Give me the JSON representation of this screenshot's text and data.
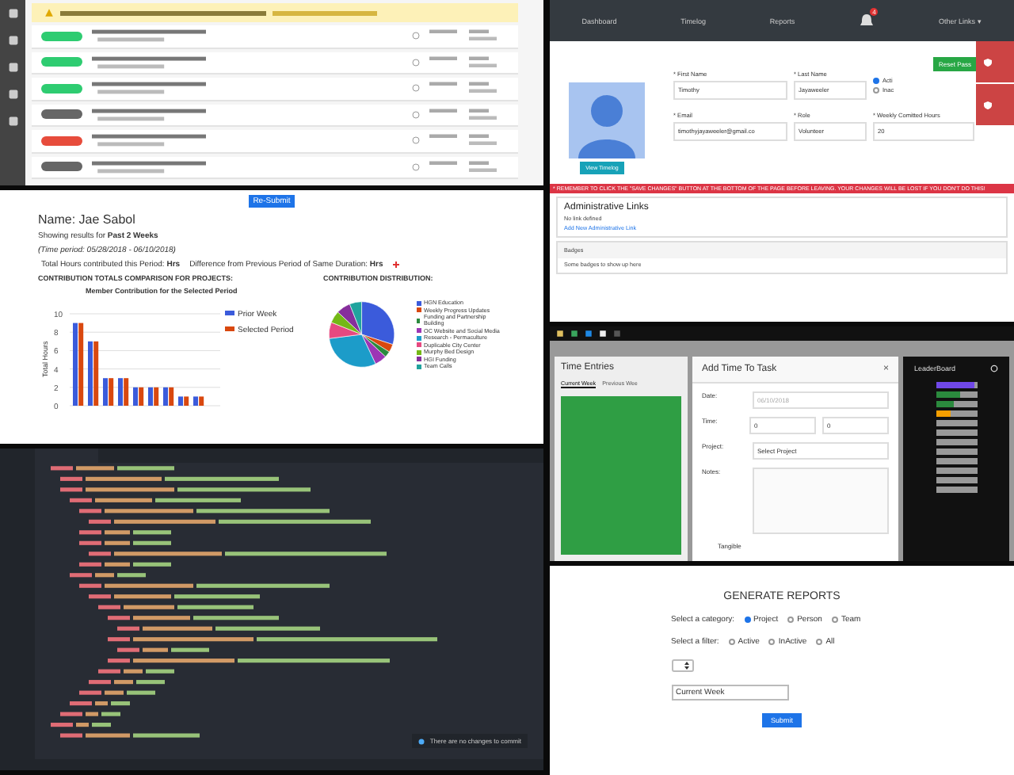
{
  "activity": {
    "rows": [
      {
        "color": "#2ecc71"
      },
      {
        "color": "#2ecc71"
      },
      {
        "color": "#2ecc71"
      },
      {
        "color": "#666666"
      },
      {
        "color": "#e74c3c"
      },
      {
        "color": "#666666"
      }
    ]
  },
  "summary": {
    "resubmit": "Re-Submit",
    "name": "Name: Jae Sabol",
    "showing": "Showing results for **Past 2 Weeks**",
    "period": "(Time period: 05/28/2018 - 06/10/2018)",
    "total": "Total Hours contributed this Period: **Hrs**",
    "difference": "Difference from Previous Period of Same Duration: **Hrs**",
    "bars_heading": "CONTRIBUTION TOTALS COMPARISON FOR PROJECTS:",
    "pie_heading": "CONTRIBUTION DISTRIBUTION:",
    "chart_data": {
      "type": "bar",
      "legend": true,
      "grid": true,
      "title": "Member Contribution for the Selected Period",
      "ylabel": "Total Hours",
      "ylim": [
        0,
        10
      ],
      "yticks": [
        0,
        2,
        4,
        6,
        8,
        10
      ],
      "series": [
        {
          "name": "Prior Week",
          "color": "#3b5bdb",
          "values": [
            9,
            7,
            3,
            3,
            2,
            2,
            2,
            1,
            1,
            0
          ]
        },
        {
          "name": "Selected Period",
          "color": "#d9480f",
          "values": [
            9,
            7,
            3,
            3,
            2,
            2,
            2,
            1,
            1,
            0
          ]
        }
      ]
    },
    "pie_legend": [
      {
        "label": "HGN Education",
        "color": "#3b5bdb"
      },
      {
        "label": "Weekly Progress Updates",
        "color": "#d9480f"
      },
      {
        "label": "Funding and Partnership Building",
        "color": "#2b8a3e"
      },
      {
        "label": "OC Website and Social Media",
        "color": "#9c36b5"
      },
      {
        "label": "Research - Permaculture",
        "color": "#1c9cc9"
      },
      {
        "label": "Duplicable City Center",
        "color": "#e64980"
      },
      {
        "label": "Murphy Bed Design",
        "color": "#74b816"
      },
      {
        "label": "HGI Funding",
        "color": "#862e9c"
      },
      {
        "label": "Team Calls",
        "color": "#20a39e"
      }
    ]
  },
  "profile": {
    "nav": [
      "Dashboard",
      "Timelog",
      "Reports"
    ],
    "notifications": "4",
    "other_links": "Other Links ▾",
    "reset": "Reset Pass",
    "view_timelog": "View Timelog",
    "fields": [
      {
        "label": "* First Name",
        "value": "Timothy"
      },
      {
        "label": "* Last Name",
        "value": "Jayaweeler"
      },
      {
        "label": "* Email",
        "value": "timothyjayaweeler@gmail.co"
      },
      {
        "label": "* Role",
        "value": "Volunteer"
      },
      {
        "label": "* Weekly Comitted Hours",
        "value": "20"
      }
    ],
    "status": [
      {
        "label": "Acti",
        "selected": true
      },
      {
        "label": "Inac",
        "selected": false
      }
    ],
    "warning": "* REMEMBER TO CLICK THE \"SAVE CHANGES\" BUTTON AT THE BOTTOM OF THE PAGE BEFORE LEAVING. YOUR CHANGES WILL BE LOST IF YOU DON'T DO THIS!",
    "admin_title": "Administrative Links",
    "admin_empty": "No link defined",
    "admin_add": "Add New Administrative Link",
    "badges_title": "Badges",
    "badges_text": "Some badges to show up here"
  },
  "timelog": {
    "title": "Time Entries",
    "tabs": [
      {
        "label": "Current Week",
        "selected": true
      },
      {
        "label": "Previous Wee",
        "selected": false
      }
    ],
    "leaderboard": "LeaderBoard",
    "leaders": [
      {
        "kind": "filled",
        "level": 0.95,
        "color": "#7048e8"
      },
      {
        "kind": "filled",
        "level": 0.6,
        "color": "#2b8a3e"
      },
      {
        "kind": "filled",
        "level": 0.45,
        "color": "#2b8a3e"
      },
      {
        "kind": "filled",
        "level": 0.35,
        "color": "#f59f00"
      },
      {
        "kind": "empty"
      },
      {
        "kind": "empty"
      },
      {
        "kind": "empty"
      },
      {
        "kind": "empty"
      },
      {
        "kind": "empty"
      },
      {
        "kind": "empty"
      },
      {
        "kind": "empty"
      },
      {
        "kind": "empty"
      }
    ],
    "modal": {
      "title": "Add Time To Task",
      "close": "×",
      "date_label": "Date:",
      "date_value": "06/10/2018",
      "time_label": "Time:",
      "hours": "0",
      "minutes": "0",
      "project_label": "Project:",
      "project": "Select Project",
      "notes_label": "Notes:",
      "tangible": "Tangible"
    }
  },
  "reports": {
    "title": "GENERATE REPORTS",
    "category_label": "Select a category:",
    "categories": [
      {
        "label": "Project",
        "selected": true
      },
      {
        "label": "Person",
        "selected": false
      },
      {
        "label": "Team",
        "selected": false
      }
    ],
    "filter_label": "Select a filter:",
    "filters": [
      {
        "label": "Active",
        "selected": false
      },
      {
        "label": "InActive",
        "selected": false
      },
      {
        "label": "All",
        "selected": false
      }
    ],
    "period": "Current Week",
    "submit": "Submit"
  },
  "editor": {
    "toast": "There are no changes to commit"
  }
}
